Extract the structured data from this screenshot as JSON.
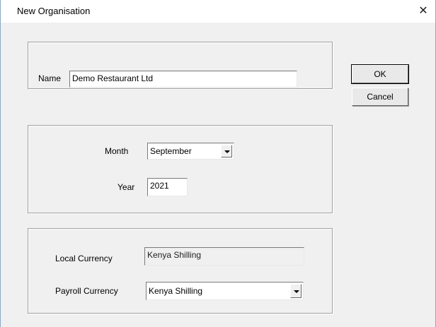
{
  "window": {
    "title": "New Organisation",
    "close_glyph": "✕"
  },
  "name_group": {
    "label": "Name",
    "value": "Demo Restaurant Ltd"
  },
  "period_group": {
    "month_label": "Month",
    "month_value": "September",
    "year_label": "Year",
    "year_value": "2021"
  },
  "currency_group": {
    "local_label": "Local Currency",
    "local_value": "Kenya Shilling",
    "payroll_label": "Payroll Currency",
    "payroll_value": "Kenya Shilling"
  },
  "buttons": {
    "ok": "OK",
    "cancel": "Cancel"
  },
  "icons": {
    "close": "close-icon",
    "dropdown": "chevron-down-icon"
  }
}
